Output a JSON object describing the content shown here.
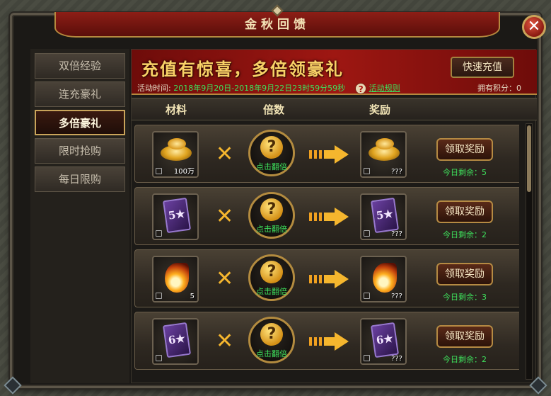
{
  "window": {
    "title": "金秋回馈",
    "close_label": "✕"
  },
  "sidebar": {
    "items": [
      {
        "label": "双倍经验",
        "active": false
      },
      {
        "label": "连充豪礼",
        "active": false
      },
      {
        "label": "多倍豪礼",
        "active": true
      },
      {
        "label": "限时抢购",
        "active": false
      },
      {
        "label": "每日限购",
        "active": false
      }
    ]
  },
  "banner": {
    "slogan": "充值有惊喜，多倍领豪礼",
    "quick_recharge": "快速充值",
    "time_label": "活动时间:",
    "time_value": "2018年9月20日-2018年9月22日23时59分59秒",
    "rules_icon": "?",
    "rules_label": "活动规则",
    "points_label": "拥有积分：0"
  },
  "columns": {
    "material": "材料",
    "multiplier": "倍数",
    "reward": "奖励"
  },
  "rows": [
    {
      "material_icon": "gold-ingot-icon",
      "material_qty": "100万",
      "mult_symbol": "✕",
      "flip_icon": "?",
      "flip_label": "点击翻倍",
      "reward_qty": "???",
      "claim_label": "领取奖励",
      "remaining": "今日剩余：5"
    },
    {
      "material_icon": "card-5-star-icon",
      "card_text": "5★",
      "material_qty": "",
      "mult_symbol": "✕",
      "flip_icon": "?",
      "flip_label": "点击翻倍",
      "reward_qty": "???",
      "claim_label": "领取奖励",
      "remaining": "今日剩余：2"
    },
    {
      "material_icon": "flame-orb-icon",
      "material_qty": "5",
      "mult_symbol": "✕",
      "flip_icon": "?",
      "flip_label": "点击翻倍",
      "reward_qty": "???",
      "claim_label": "领取奖励",
      "remaining": "今日剩余：3"
    },
    {
      "material_icon": "card-6-star-icon",
      "card_text": "6★",
      "material_qty": "",
      "mult_symbol": "✕",
      "flip_icon": "?",
      "flip_label": "点击翻倍",
      "reward_qty": "???",
      "claim_label": "领取奖励",
      "remaining": "今日剩余：2"
    }
  ],
  "colors": {
    "accent_red": "#9e1712",
    "gold": "#c9a45a",
    "green_text": "#3ee05c"
  }
}
